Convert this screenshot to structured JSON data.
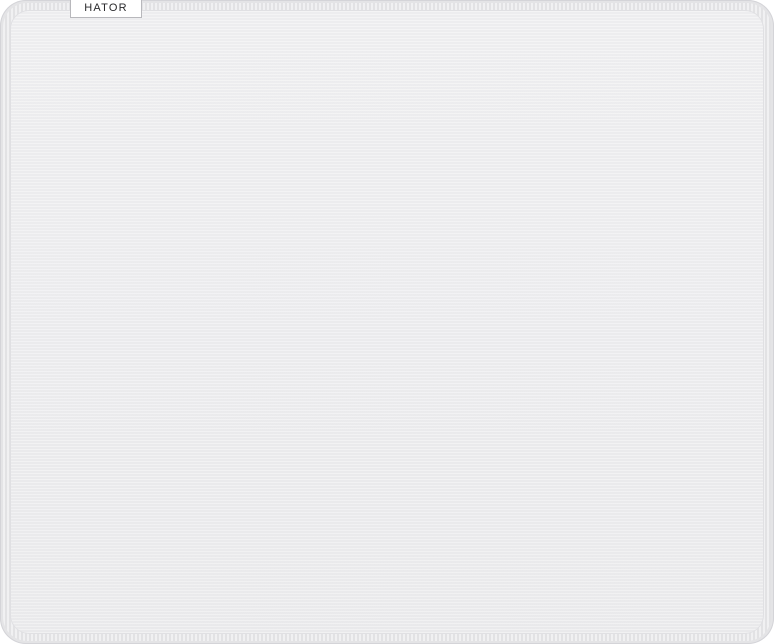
{
  "product": {
    "brand": "HATOR",
    "surface_color": "#eeeef0",
    "edge_color": "#e4e4e6"
  }
}
